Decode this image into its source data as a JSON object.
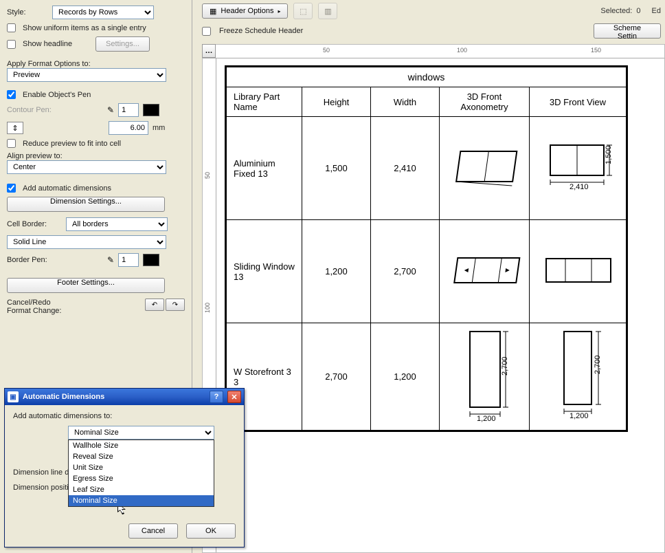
{
  "sidebar": {
    "style_label": "Style:",
    "style_value": "Records by Rows",
    "uniform": "Show uniform items as a single entry",
    "headline": "Show headline",
    "settings": "Settings...",
    "apply_format": "Apply Format Options to:",
    "apply_value": "Preview",
    "enable_pen": "Enable Object's Pen",
    "contour_pen": "Contour Pen:",
    "contour_val": "1",
    "thickness": "6.00",
    "thickness_unit": "mm",
    "reduce": "Reduce preview to fit into cell",
    "align": "Align preview to:",
    "align_value": "Center",
    "add_dims": "Add automatic dimensions",
    "dim_settings": "Dimension Settings...",
    "cell_border": "Cell Border:",
    "cell_border_value": "All borders",
    "line_type": "Solid Line",
    "border_pen": "Border Pen:",
    "border_pen_val": "1",
    "footer": "Footer Settings...",
    "cancel_redo1": "Cancel/Redo",
    "cancel_redo2": "Format Change:"
  },
  "topbar": {
    "header_options": "Header Options",
    "freeze": "Freeze Schedule Header",
    "selected": "Selected:",
    "selected_n": "0",
    "editable": "Ed",
    "scheme": "Scheme Settin"
  },
  "ruler": {
    "h": [
      "50",
      "100",
      "150"
    ],
    "v": [
      "50",
      "100"
    ]
  },
  "schedule": {
    "title": "windows",
    "cols": [
      "Library Part Name",
      "Height",
      "Width",
      "3D Front Axonometry",
      "3D Front View"
    ],
    "rows": [
      {
        "name": "Aluminium Fixed 13",
        "h": "1,500",
        "w": "2,410",
        "d1": "2,410",
        "d2": "1,500"
      },
      {
        "name": "Sliding Window 13",
        "h": "1,200",
        "w": "2,700",
        "d1": "",
        "d2": ""
      },
      {
        "name": "W Storefront 3 3",
        "h": "2,700",
        "w": "1,200",
        "d1": "1,200",
        "d2": "2,700"
      }
    ]
  },
  "dialog": {
    "title": "Automatic Dimensions",
    "add_to": "Add automatic dimensions to:",
    "combo_value": "Nominal Size",
    "options": [
      "Wallhole Size",
      "Reveal Size",
      "Unit Size",
      "Egress Size",
      "Leaf Size",
      "Nominal Size"
    ],
    "dim_line": "Dimension line di",
    "dim_pos": "Dimension positi",
    "ok": "OK",
    "cancel": "Cancel"
  }
}
